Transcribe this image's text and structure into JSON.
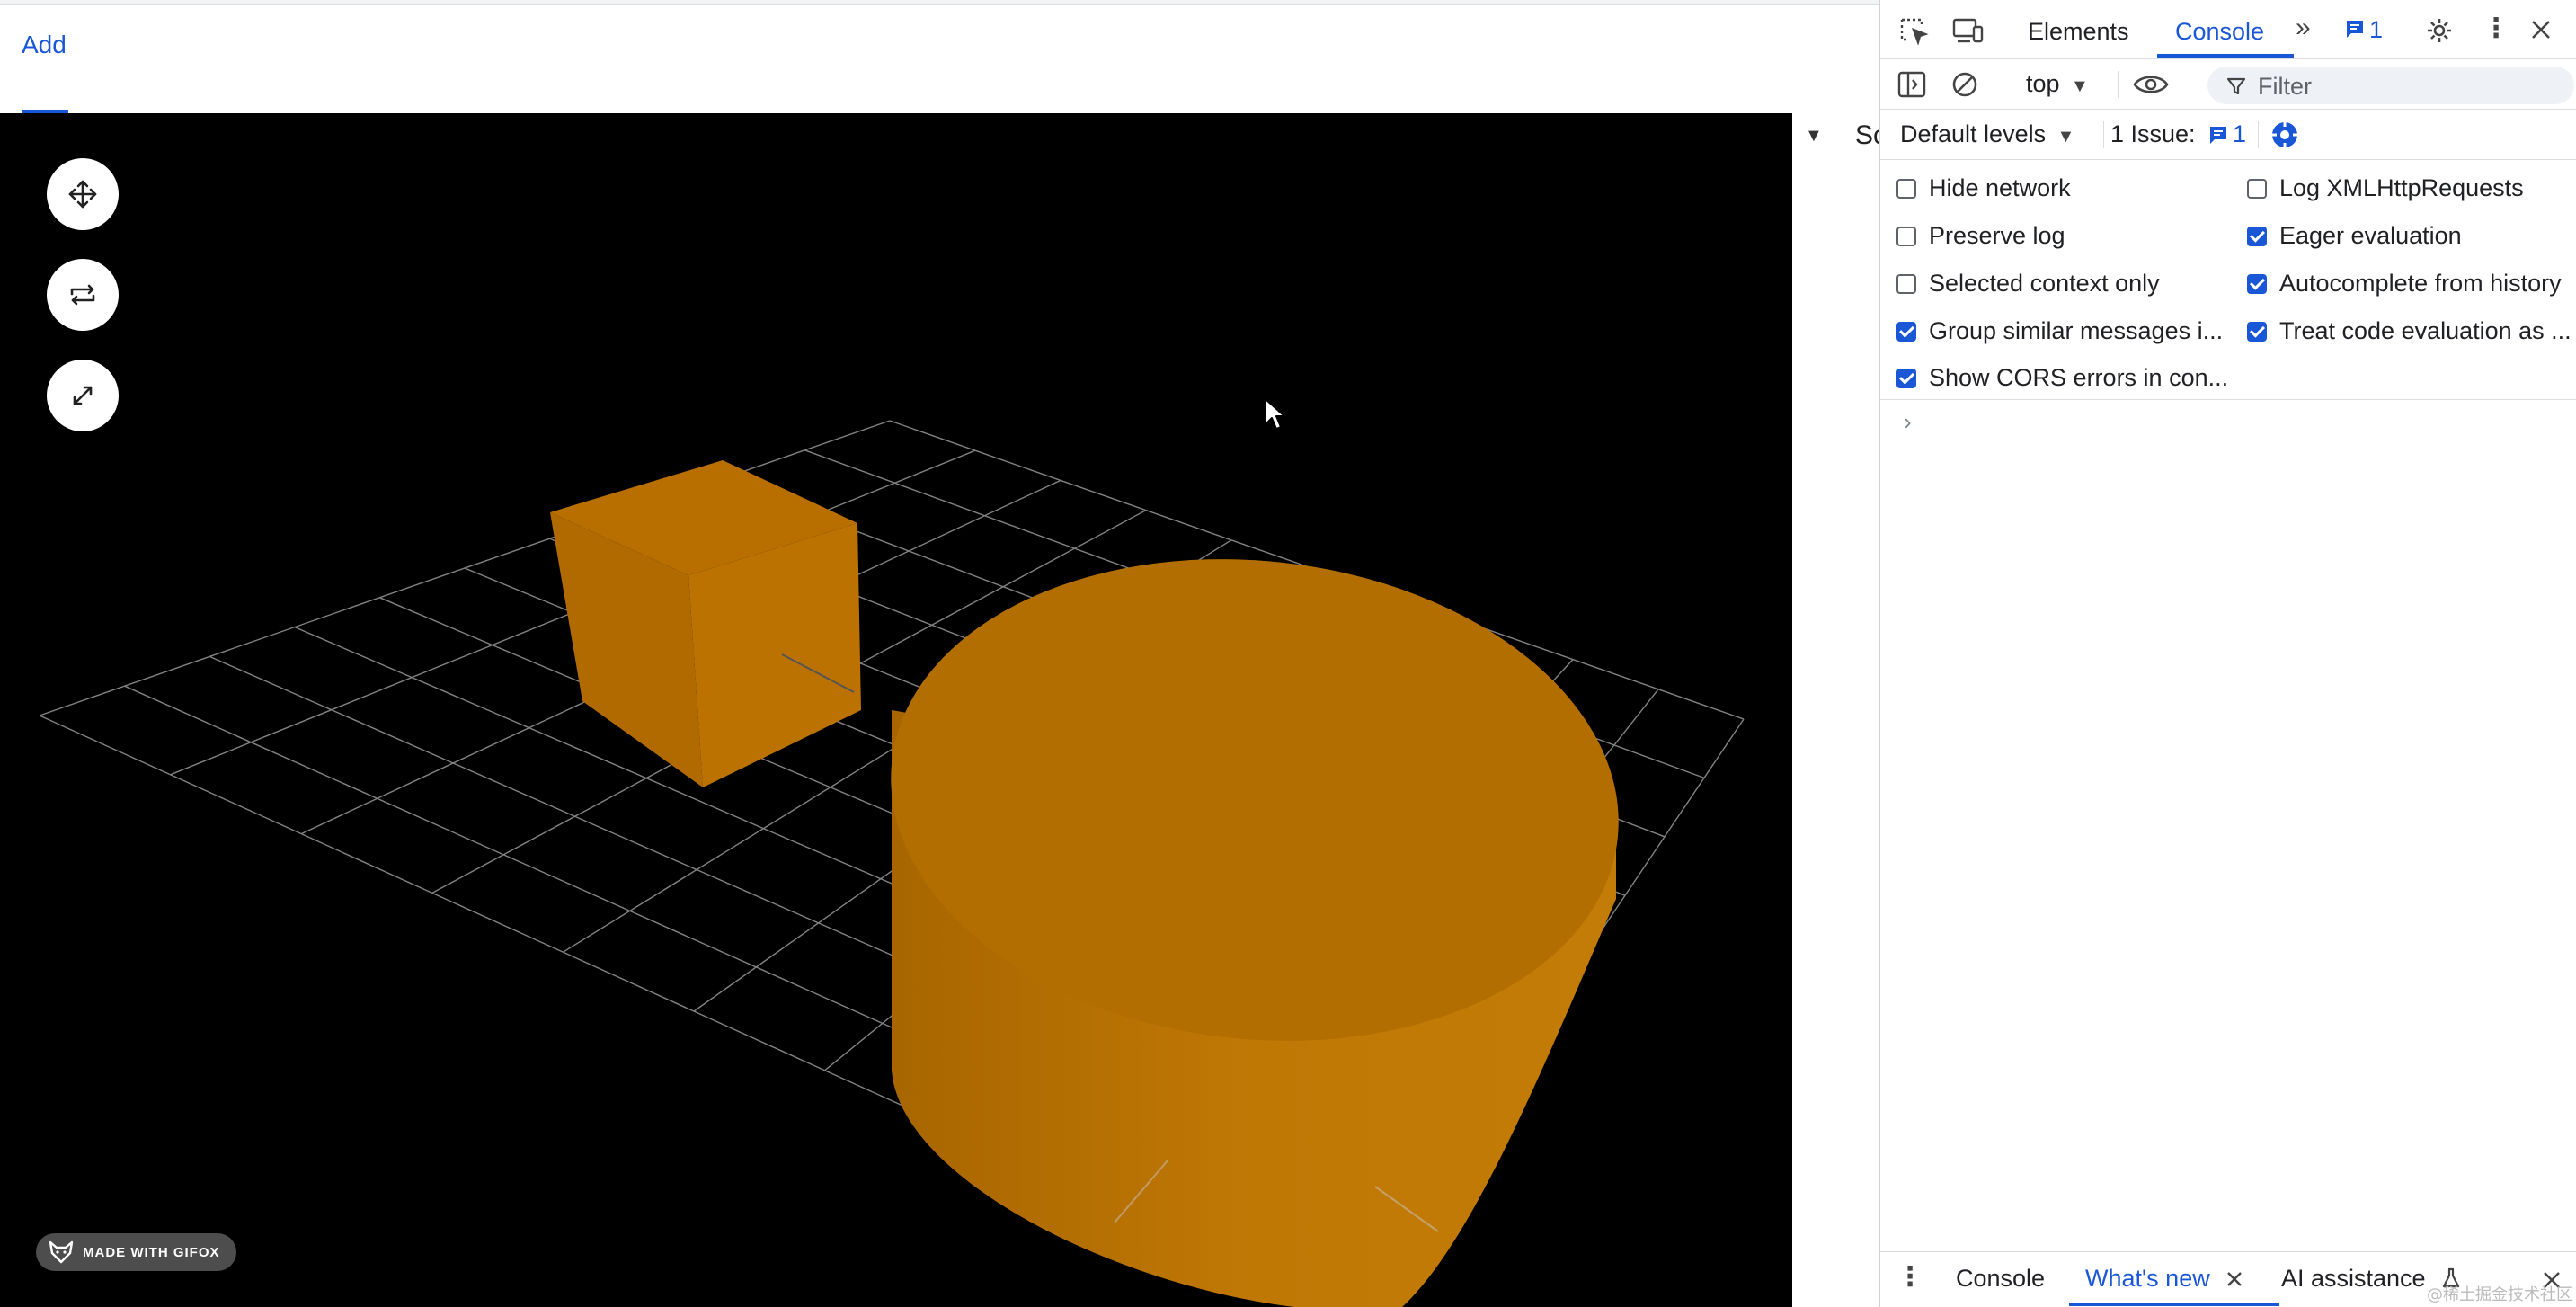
{
  "app": {
    "tab_label": "Add",
    "side_panel_text": "Sc",
    "badge_text": "MADE WITH GIFOX",
    "accent_color": "#1a57d6",
    "shape_color": "#c07805"
  },
  "viewport_controls": [
    {
      "name": "move-icon"
    },
    {
      "name": "rotate-icon"
    },
    {
      "name": "scale-icon"
    }
  ],
  "devtools": {
    "tabs": [
      "Elements",
      "Console"
    ],
    "issue_badge_count": "1",
    "context": "top",
    "filter_placeholder": "Filter",
    "levels": "Default levels",
    "issues_label": "1 Issue:",
    "issues_count": "1",
    "settings_left": [
      {
        "label": "Hide network",
        "checked": false
      },
      {
        "label": "Preserve log",
        "checked": false
      },
      {
        "label": "Selected context only",
        "checked": false
      },
      {
        "label": "Group similar messages i...",
        "checked": true
      },
      {
        "label": "Show CORS errors in con...",
        "checked": true
      }
    ],
    "settings_right": [
      {
        "label": "Log XMLHttpRequests",
        "checked": false
      },
      {
        "label": "Eager evaluation",
        "checked": true
      },
      {
        "label": "Autocomplete from history",
        "checked": true
      },
      {
        "label": "Treat code evaluation as ...",
        "checked": true
      }
    ],
    "drawer_tabs": [
      "Console",
      "What's new",
      "AI assistance"
    ]
  },
  "watermark": "@稀土掘金技术社区"
}
